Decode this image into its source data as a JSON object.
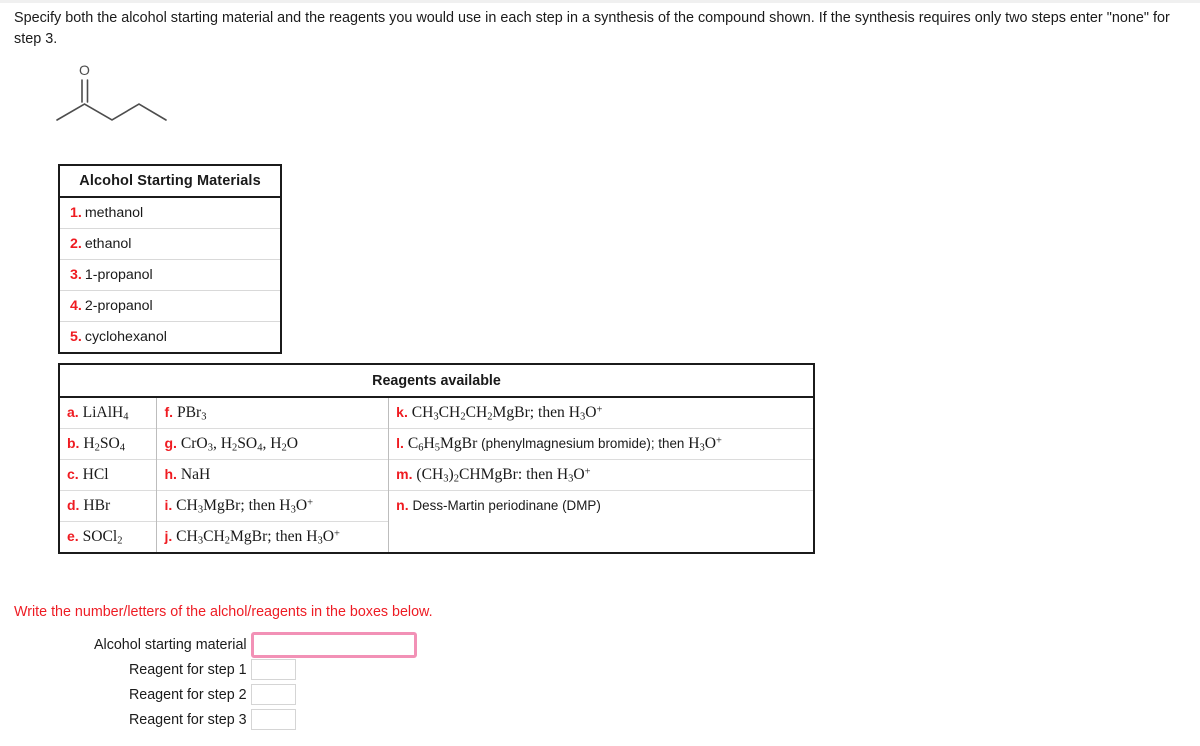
{
  "prompt": "Specify both the alcohol starting material and the reagents you would use in each step in a synthesis of the compound shown. If the synthesis requires only two steps enter \"none\" for step 3.",
  "molecule": {
    "name": "2-pentanone",
    "oxygen_label": "O"
  },
  "alcohol_table": {
    "header": "Alcohol Starting Materials",
    "items": [
      {
        "label": "1.",
        "name": "methanol"
      },
      {
        "label": "2.",
        "name": "ethanol"
      },
      {
        "label": "3.",
        "name": "1-propanol"
      },
      {
        "label": "4.",
        "name": "2-propanol"
      },
      {
        "label": "5.",
        "name": "cyclohexanol"
      }
    ]
  },
  "reagents_table": {
    "header": "Reagents available",
    "column1": [
      {
        "label": "a.",
        "formula_html": "LiAlH<sub>4</sub>"
      },
      {
        "label": "b.",
        "formula_html": "H<sub>2</sub>SO<sub>4</sub>"
      },
      {
        "label": "c.",
        "formula_html": "HCl"
      },
      {
        "label": "d.",
        "formula_html": "HBr"
      },
      {
        "label": "e.",
        "formula_html": "SOCl<sub>2</sub>"
      }
    ],
    "column2": [
      {
        "label": "f.",
        "formula_html": "PBr<sub>3</sub>"
      },
      {
        "label": "g.",
        "formula_html": "CrO<sub>3</sub>, H<sub>2</sub>SO<sub>4</sub>, H<sub>2</sub>O"
      },
      {
        "label": "h.",
        "formula_html": "NaH"
      },
      {
        "label": "i.",
        "formula_html": "CH<sub>3</sub>MgBr; then H<sub>3</sub>O<sup>+</sup>"
      },
      {
        "label": "j.",
        "formula_html": "CH<sub>3</sub>CH<sub>2</sub>MgBr; then H<sub>3</sub>O<sup>+</sup>"
      }
    ],
    "column3": [
      {
        "label": "k.",
        "formula_html": "CH<sub>3</sub>CH<sub>2</sub>CH<sub>2</sub>MgBr; then H<sub>3</sub>O<sup>+</sup>"
      },
      {
        "label": "l.",
        "formula_html": "C<sub>6</sub>H<sub>5</sub>MgBr <span class=\"plain\">(phenylmagnesium bromide); then</span> H<sub>3</sub>O<sup>+</sup>"
      },
      {
        "label": "m.",
        "formula_html": "(CH<sub>3</sub>)<sub>2</sub>CHMgBr: then H<sub>3</sub>O<sup>+</sup>"
      },
      {
        "label": "n.",
        "formula_html": "<span class=\"plain\">Dess-Martin periodinane (DMP)</span>"
      }
    ]
  },
  "answer_section": {
    "instruction": "Write the number/letters of the alchol/reagents in the boxes below.",
    "rows": [
      {
        "label": "Alcohol starting material",
        "value": "",
        "focused": true
      },
      {
        "label": "Reagent for step 1",
        "value": "",
        "focused": false
      },
      {
        "label": "Reagent for step 2",
        "value": "",
        "focused": false
      },
      {
        "label": "Reagent for step 3",
        "value": "",
        "focused": false
      }
    ]
  },
  "colors": {
    "label_red": "#ef1b21",
    "instruction_red": "#ee1c24",
    "focus_pink": "#f291b6",
    "table_border": "#1b1b1b"
  }
}
